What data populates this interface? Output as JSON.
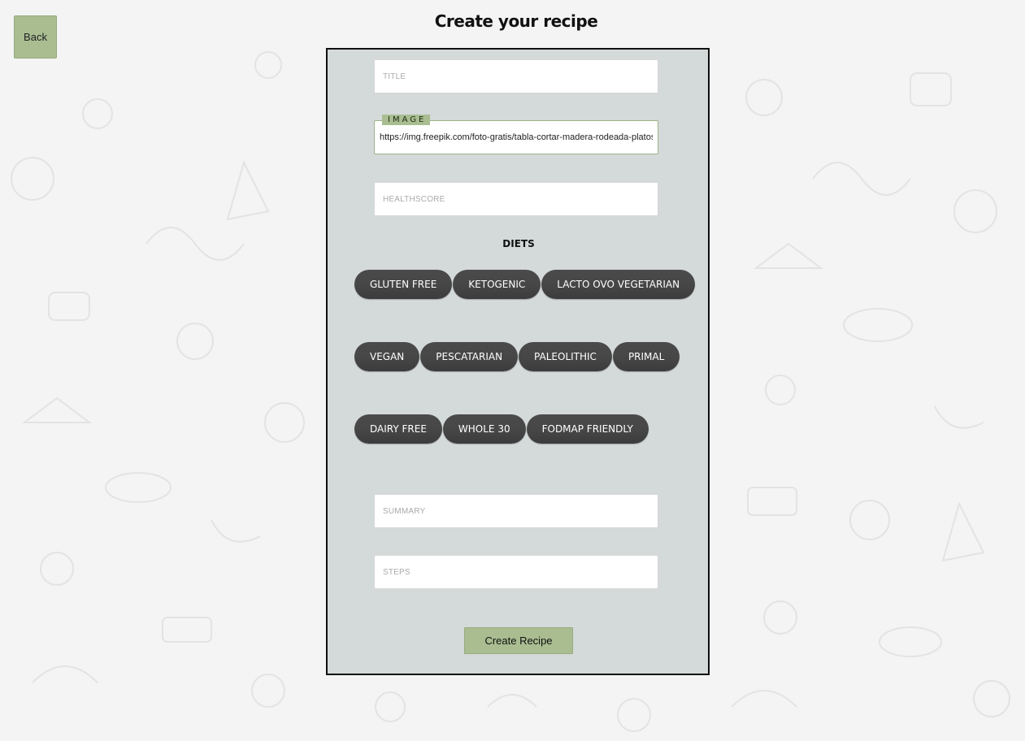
{
  "header": {
    "back_label": "Back",
    "title": "Create your recipe"
  },
  "form": {
    "title_placeholder": "TITLE",
    "image_label": "IMAGE",
    "image_value": "https://img.freepik.com/foto-gratis/tabla-cortar-madera-rodeada-platos",
    "healthscore_placeholder": "HEALTHSCORE",
    "diets_heading": "DIETS",
    "diets": [
      [
        "GLUTEN FREE",
        "KETOGENIC",
        "LACTO OVO VEGETARIAN"
      ],
      [
        "VEGAN",
        "PESCATARIAN",
        "PALEOLITHIC",
        "PRIMAL"
      ],
      [
        "DAIRY FREE",
        "WHOLE 30",
        "FODMAP FRIENDLY"
      ]
    ],
    "summary_placeholder": "SUMMARY",
    "steps_placeholder": "STEPS",
    "submit_label": "Create Recipe"
  },
  "colors": {
    "accent": "#a9bd91",
    "panel": "#d4d9d9",
    "chip": "#474747",
    "background": "#f3f4f3"
  }
}
